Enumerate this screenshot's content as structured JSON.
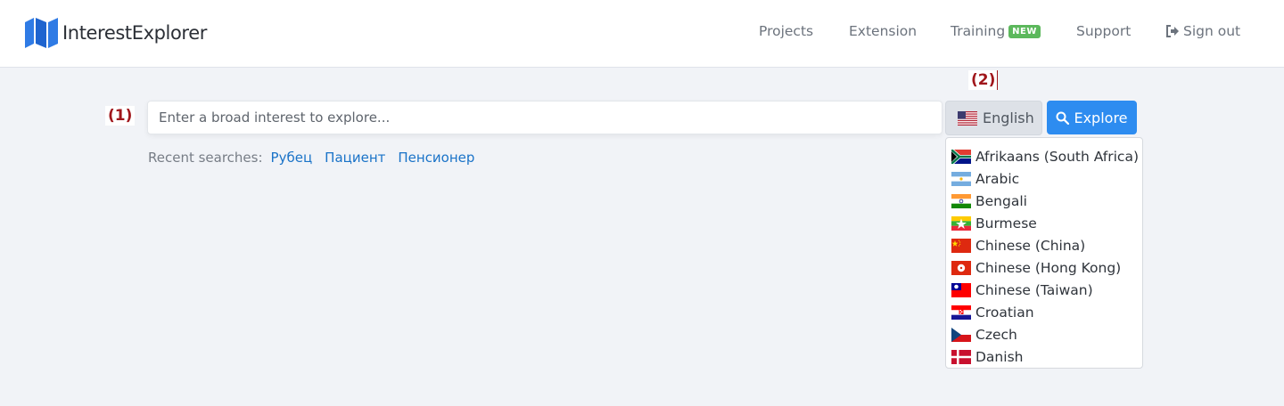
{
  "app": {
    "logo_text": "InterestExplorer"
  },
  "nav": {
    "projects": "Projects",
    "extension": "Extension",
    "training": "Training",
    "training_badge": "NEW",
    "support": "Support",
    "signout": "Sign out"
  },
  "annotations": {
    "a1": "(1)",
    "a2": "(2)"
  },
  "search": {
    "placeholder": "Enter a broad interest to explore...",
    "value": ""
  },
  "language": {
    "selected": "English",
    "selected_flag": "us-flag-icon"
  },
  "explore_button": {
    "label": "Explore",
    "icon": "search-icon",
    "color": "#2d8cf0"
  },
  "recent": {
    "label": "Recent searches:",
    "items": [
      "Рубец",
      "Пациент",
      "Пенсионер"
    ]
  },
  "dropdown": {
    "items": [
      {
        "label": "Afrikaans (South Africa)",
        "flag": "za-flag-icon"
      },
      {
        "label": "Arabic",
        "flag": "ar-flag-icon"
      },
      {
        "label": "Bengali",
        "flag": "in-flag-icon"
      },
      {
        "label": "Burmese",
        "flag": "mm-flag-icon"
      },
      {
        "label": "Chinese (China)",
        "flag": "cn-flag-icon"
      },
      {
        "label": "Chinese (Hong Kong)",
        "flag": "hk-flag-icon"
      },
      {
        "label": "Chinese (Taiwan)",
        "flag": "tw-flag-icon"
      },
      {
        "label": "Croatian",
        "flag": "hr-flag-icon"
      },
      {
        "label": "Czech",
        "flag": "cz-flag-icon"
      },
      {
        "label": "Danish",
        "flag": "dk-flag-icon"
      }
    ]
  },
  "colors": {
    "accent": "#2d8cf0",
    "badge": "#5cb85c",
    "annotation": "#a0161b",
    "link": "#1a73c8"
  }
}
